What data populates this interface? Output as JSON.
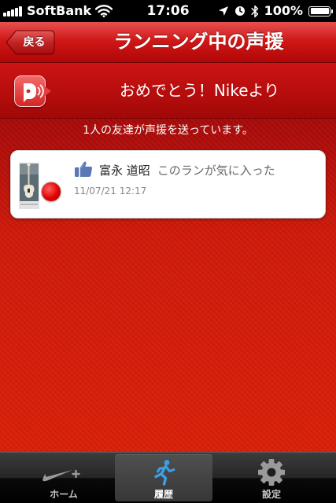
{
  "status_bar": {
    "carrier": "SoftBank",
    "time": "17:06",
    "battery_percent": "100%",
    "icons": [
      "signal-icon",
      "wifi-icon",
      "location-icon",
      "alarm-icon",
      "bluetooth-icon",
      "battery-icon"
    ]
  },
  "nav": {
    "back_label": "戻る",
    "title": "ランニング中の声援"
  },
  "cheer_header": {
    "icon": "cheer-speaker-icon",
    "title": "おめでとう！Nikeより"
  },
  "summary": "1人の友達が声援を送っています。",
  "cheers": [
    {
      "friend_name": "富永 道昭",
      "message": "このランが気に入った",
      "timestamp": "11/07/21 12:17",
      "icon": "like-thumbs-up-icon"
    }
  ],
  "tabs": [
    {
      "label": "ホーム",
      "icon": "nike-plus-icon",
      "selected": false
    },
    {
      "label": "履歴",
      "icon": "runner-icon",
      "selected": true
    },
    {
      "label": "設定",
      "icon": "gear-icon",
      "selected": false
    }
  ],
  "colors": {
    "nav_red": "#d01818",
    "background_red": "#c81208",
    "tab_bar": "#000000",
    "runner_blue": "#3aa0e8"
  }
}
